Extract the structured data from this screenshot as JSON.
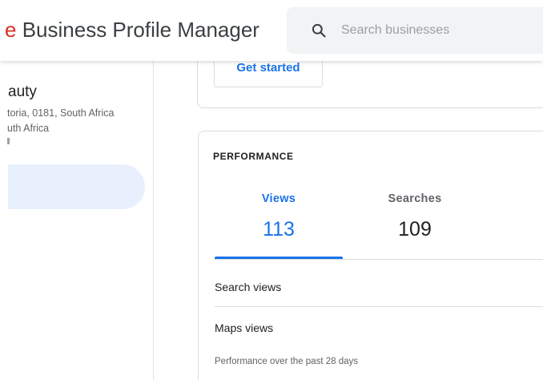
{
  "header": {
    "title_prefix": "e",
    "title": " Business Profile Manager",
    "search": {
      "placeholder": "Search businesses",
      "icon": "search-icon"
    }
  },
  "sidebar": {
    "business_name": "auty",
    "address_line": "toria, 0181, South Africa",
    "country_line": "uth Africa"
  },
  "setup_card": {
    "get_started_label": "Get started"
  },
  "performance": {
    "title": "PERFORMANCE",
    "tabs": [
      {
        "label": "Views",
        "count": "113",
        "selected": true
      },
      {
        "label": "Searches",
        "count": "109",
        "selected": false
      }
    ],
    "rows": [
      {
        "label": "Search views"
      },
      {
        "label": "Maps views"
      }
    ],
    "footnote": "Performance over the past 28 days"
  },
  "colors": {
    "accent": "#1a73e8",
    "brand_red": "#d93025",
    "selected_pill": "#e8f0fe"
  }
}
